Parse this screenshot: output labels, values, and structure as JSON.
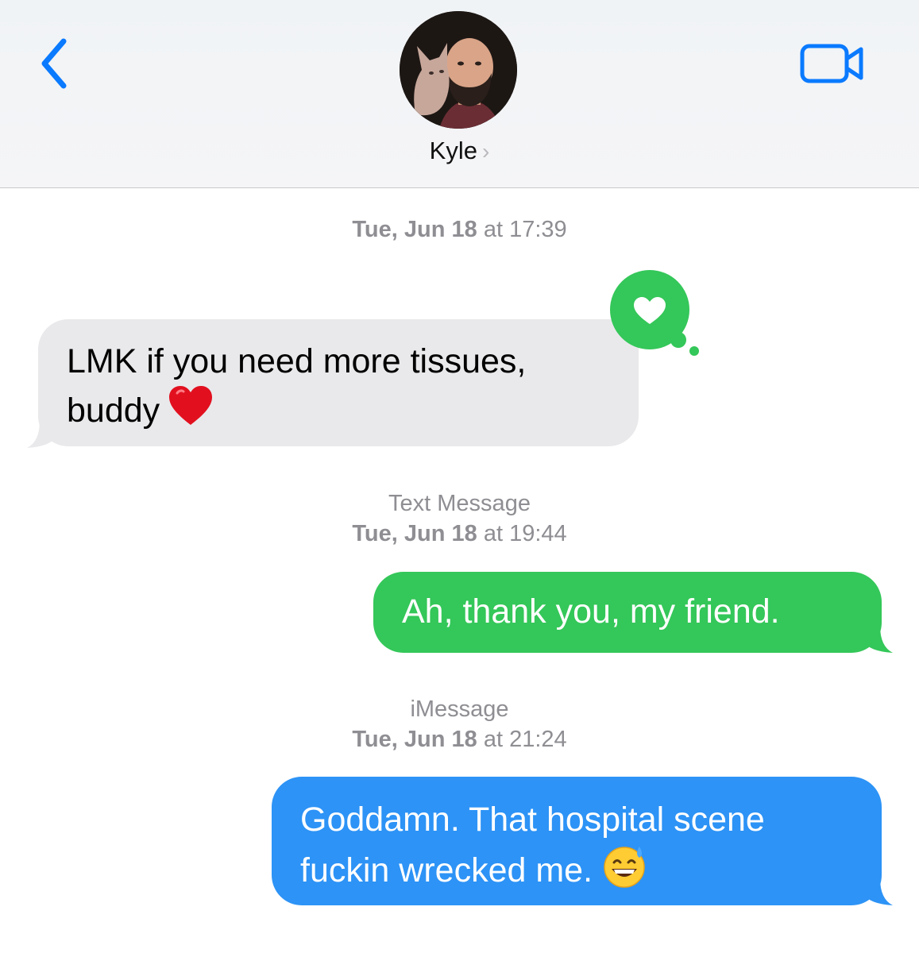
{
  "header": {
    "contact_name": "Kyle",
    "chevron": "›",
    "back_icon": "chevron-left-icon",
    "video_icon": "video-camera-icon",
    "accent_color": "#0a7aff"
  },
  "messages": [
    {
      "timestamp": {
        "day": "Tue, Jun 18",
        "at": "at",
        "time": "17:39"
      },
      "direction": "received",
      "text": "LMK if you need more tissues, buddy",
      "emoji": "red-heart-icon",
      "reaction": "heart-tapback-icon"
    },
    {
      "service": "Text Message",
      "timestamp": {
        "day": "Tue, Jun 18",
        "at": "at",
        "time": "19:44"
      },
      "direction": "sent",
      "text": "Ah, thank you, my friend.",
      "color": "#34c759"
    },
    {
      "service": "iMessage",
      "timestamp": {
        "day": "Tue, Jun 18",
        "at": "at",
        "time": "21:24"
      },
      "direction": "sent",
      "text": "Goddamn. That hospital scene fuckin wrecked me.",
      "emoji": "grinning-sweat-face-icon",
      "color": "#2d93f6"
    }
  ]
}
